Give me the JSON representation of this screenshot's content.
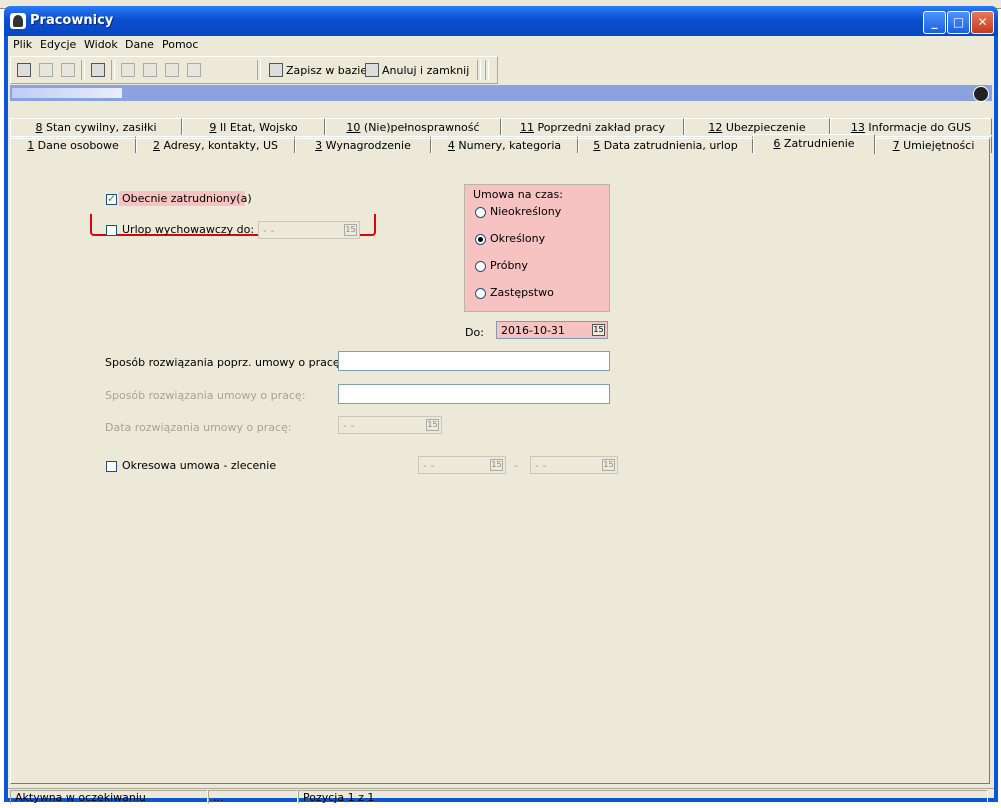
{
  "window": {
    "title": "Pracownicy",
    "controls": {
      "minimize": "_",
      "maximize": "□",
      "close": "✕"
    }
  },
  "menu": [
    "Plik",
    "Edycje",
    "Widok",
    "Dane",
    "Pomoc"
  ],
  "toolbar": {
    "save_label": "Zapisz w bazie",
    "cancel_label": "Anuluj i zamknij"
  },
  "tabs_top": [
    {
      "num": "8",
      "label": " Stan cywilny, zasiłki"
    },
    {
      "num": "9",
      "label": " II Etat, Wojsko"
    },
    {
      "num": "10",
      "label": " (Nie)pełnosprawność"
    },
    {
      "num": "11",
      "label": " Poprzedni zakład pracy"
    },
    {
      "num": "12",
      "label": " Ubezpieczenie"
    },
    {
      "num": "13",
      "label": " Informacje do GUS"
    }
  ],
  "tabs_bottom": [
    {
      "num": "1",
      "label": " Dane osobowe"
    },
    {
      "num": "2",
      "label": " Adresy, kontakty, US"
    },
    {
      "num": "3",
      "label": " Wynagrodzenie"
    },
    {
      "num": "4",
      "label": " Numery, kategoria"
    },
    {
      "num": "5",
      "label": " Data zatrudnienia, urlop"
    },
    {
      "num": "6",
      "label": " Zatrudnienie"
    },
    {
      "num": "7",
      "label": " Umiejętności"
    }
  ],
  "form": {
    "employed_label": "Obecnie zatrudniony(a)",
    "employed_checked": true,
    "parental_leave_label": "Urlop wychowawczy do:",
    "parental_leave_value": "- -",
    "contract_group_title": "Umowa na czas:",
    "contract_options": [
      "Nieokreślony",
      "Określony",
      "Próbny",
      "Zastępstwo"
    ],
    "contract_selected": "Określony",
    "until_label": "Do:",
    "until_value": "2016-10-31",
    "prev_termination_label": "Sposób rozwiązania poprz. umowy o pracę:",
    "prev_termination_value": "",
    "termination_label": "Sposób rozwiązania umowy o pracę:",
    "termination_value": "",
    "termination_date_label": "Data rozwiązania umowy o pracę:",
    "termination_date_value": "- -",
    "mandate_label": "Okresowa umowa - zlecenie",
    "mandate_from": "- -",
    "mandate_dash": "-",
    "mandate_to": "- -"
  },
  "status": {
    "state": "Aktywna w oczekiwaniu",
    "dots": "...",
    "position": "Pozycja 1 z 1"
  }
}
